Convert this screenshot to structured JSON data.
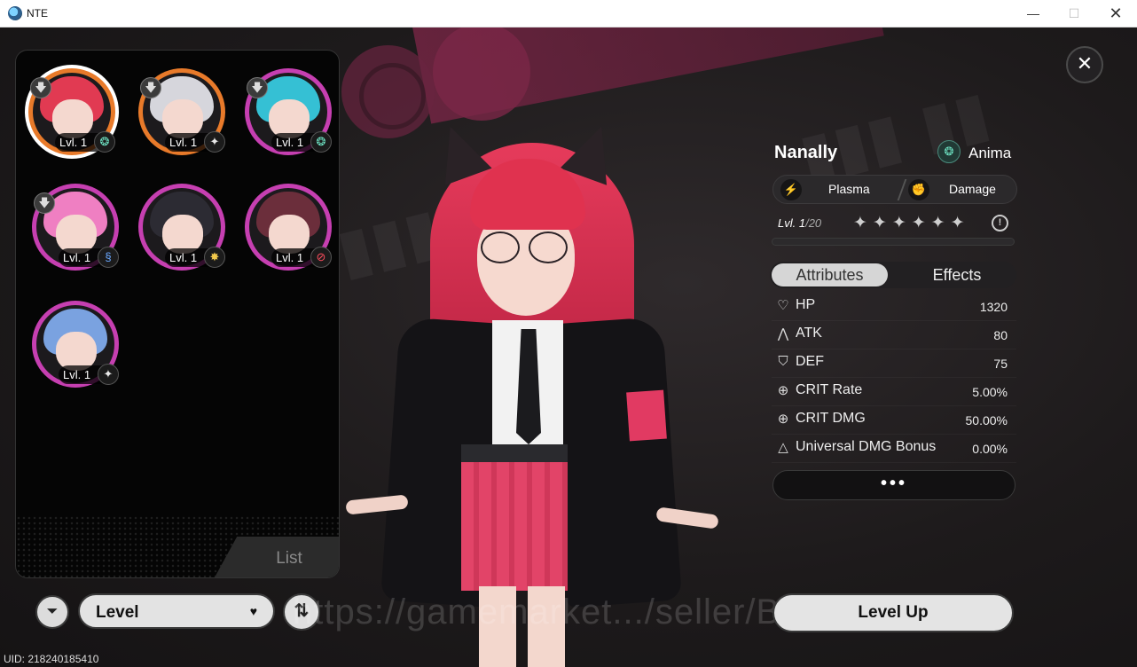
{
  "window": {
    "title": "NTE",
    "minimize": "—",
    "maximize": "☐",
    "close": "✕"
  },
  "roster": {
    "list_tab": "List",
    "characters": [
      {
        "level": "Lvl. 1",
        "locked_icon": "🡇",
        "element_icon": "❂",
        "element": "anima",
        "ring": "#e87a2a",
        "hair": "#e13a52",
        "selected": true
      },
      {
        "level": "Lvl. 1",
        "locked_icon": "🡇",
        "element_icon": "✦",
        "element": "cosmos",
        "ring": "#e87a2a",
        "hair": "#d6d6dc",
        "selected": false
      },
      {
        "level": "Lvl. 1",
        "locked_icon": "🡇",
        "element_icon": "❂",
        "element": "anima",
        "ring": "#c63fb1",
        "hair": "#35c0d4",
        "selected": false
      },
      {
        "level": "Lvl. 1",
        "locked_icon": "🡇",
        "element_icon": "§",
        "element": "psyche",
        "ring": "#c63fb1",
        "hair": "#ef7fc2",
        "selected": false
      },
      {
        "level": "Lvl. 1",
        "locked_icon": "",
        "element_icon": "✸",
        "element": "lakshana",
        "ring": "#c63fb1",
        "hair": "#2c2b33",
        "selected": false
      },
      {
        "level": "Lvl. 1",
        "locked_icon": "",
        "element_icon": "⊘",
        "element": "incantation",
        "ring": "#c63fb1",
        "hair": "#6b2e3b",
        "selected": false
      },
      {
        "level": "Lvl. 1",
        "locked_icon": "",
        "element_icon": "✦",
        "element": "cosmos",
        "ring": "#c63fb1",
        "hair": "#7aa2e0",
        "selected": false
      }
    ]
  },
  "controls": {
    "filter_icon": "⏷",
    "sort_label": "Level",
    "sort_caret": "♥",
    "order_icon": "⇅"
  },
  "uid": "UID: 218240185410",
  "watermark": "https://gamemarket.../seller/BangJo...",
  "character": {
    "close_icon": "✕",
    "name": "Nanally",
    "element": "Anima",
    "element_icon": "❂",
    "traits": [
      {
        "icon": "⚡",
        "label": "Plasma"
      },
      {
        "icon": "✊",
        "label": "Damage"
      }
    ],
    "level_label": "Lvl. 1",
    "level_max": "/20",
    "stars": "✦✦✦✦✦✦",
    "info_icon": "!",
    "exp_fraction": 0,
    "tabs": {
      "attributes": "Attributes",
      "effects": "Effects"
    },
    "stats": [
      {
        "icon": "♡",
        "name": "HP",
        "value": "1320"
      },
      {
        "icon": "⋀",
        "name": "ATK",
        "value": "80"
      },
      {
        "icon": "⛉",
        "name": "DEF",
        "value": "75"
      },
      {
        "icon": "⊕",
        "name": "CRIT Rate",
        "value": "5.00%"
      },
      {
        "icon": "⊕",
        "name": "CRIT DMG",
        "value": "50.00%"
      },
      {
        "icon": "△",
        "name": "Universal DMG Bonus",
        "value": "0.00%"
      }
    ],
    "more": "•••",
    "level_up": "Level Up"
  },
  "colors": {
    "accent_pink": "#e13a62",
    "panel_dark": "#050505",
    "button_light": "#e3e3e3"
  }
}
